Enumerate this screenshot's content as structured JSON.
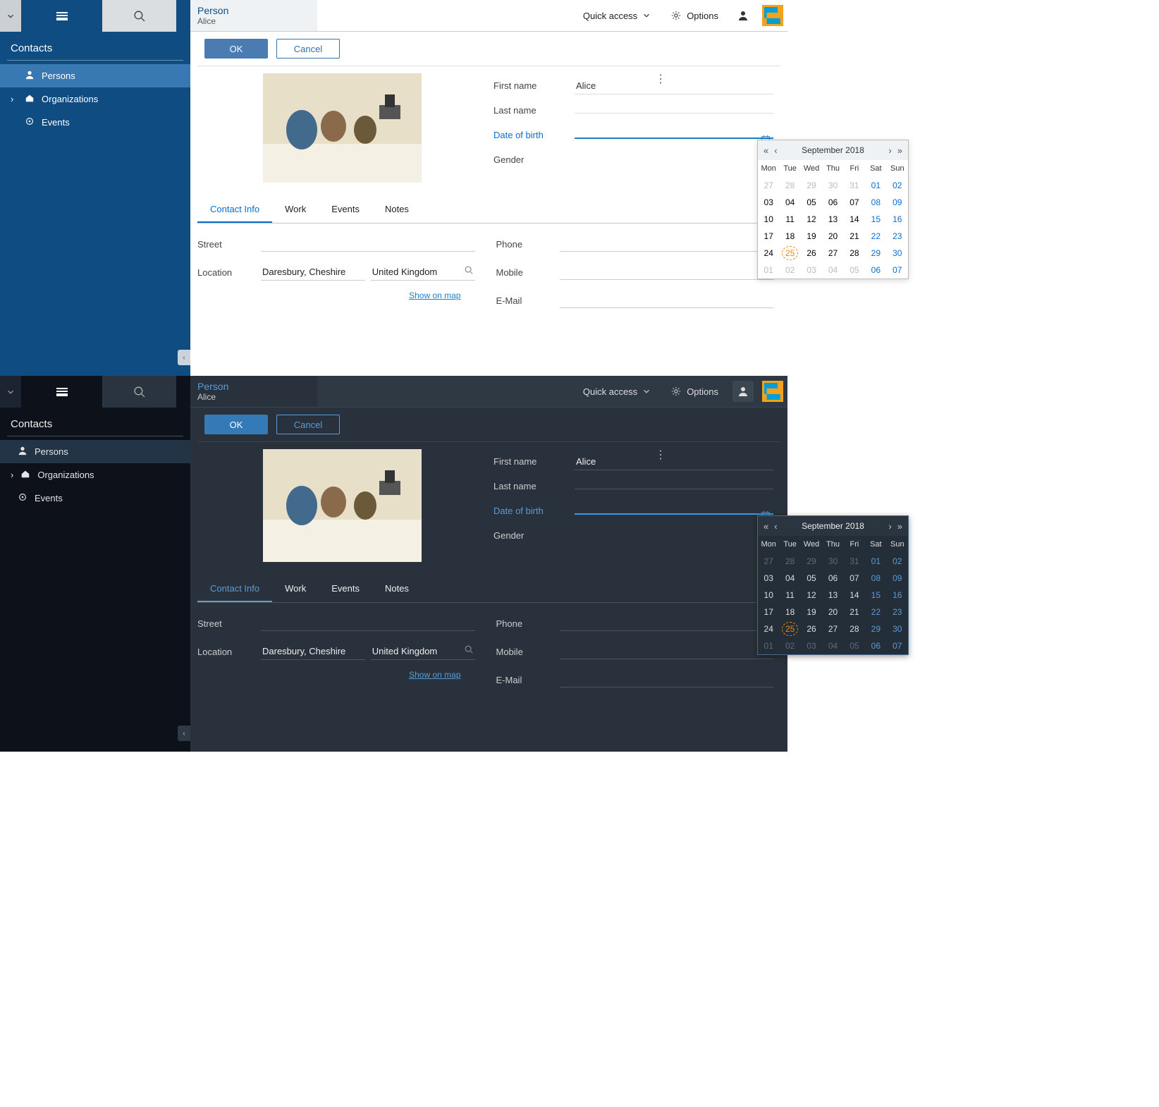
{
  "sidebar": {
    "title": "Contacts",
    "items": [
      {
        "label": "Persons",
        "active": true,
        "expandable": false,
        "icon": "person"
      },
      {
        "label": "Organizations",
        "active": false,
        "expandable": true,
        "icon": "home"
      },
      {
        "label": "Events",
        "active": false,
        "expandable": false,
        "icon": "target"
      }
    ]
  },
  "header": {
    "title": "Person",
    "subtitle": "Alice",
    "quick_access": "Quick access",
    "options": "Options"
  },
  "actions": {
    "ok": "OK",
    "cancel": "Cancel"
  },
  "tabs": [
    {
      "label": "Contact Info",
      "active": true
    },
    {
      "label": "Work",
      "active": false
    },
    {
      "label": "Events",
      "active": false
    },
    {
      "label": "Notes",
      "active": false
    }
  ],
  "fields": {
    "first_name_label": "First name",
    "first_name_value": "Alice",
    "last_name_label": "Last name",
    "last_name_value": "",
    "dob_label": "Date of birth",
    "dob_value": "",
    "gender_label": "Gender",
    "gender_value": ""
  },
  "address": {
    "street_label": "Street",
    "street_value": "",
    "location_label": "Location",
    "city_value": "Daresbury, Cheshire",
    "country_value": "United Kingdom",
    "show_on_map": "Show on map"
  },
  "contact": {
    "phone_label": "Phone",
    "mobile_label": "Mobile",
    "email_label": "E-Mail"
  },
  "calendar": {
    "title": "September 2018",
    "day_headers": [
      "Mon",
      "Tue",
      "Wed",
      "Thu",
      "Fri",
      "Sat",
      "Sun"
    ],
    "rows": [
      [
        {
          "d": "27",
          "cls": "gray"
        },
        {
          "d": "28",
          "cls": "gray"
        },
        {
          "d": "29",
          "cls": "gray"
        },
        {
          "d": "30",
          "cls": "gray"
        },
        {
          "d": "31",
          "cls": "gray"
        },
        {
          "d": "01",
          "cls": "blue"
        },
        {
          "d": "02",
          "cls": "blue"
        }
      ],
      [
        {
          "d": "03"
        },
        {
          "d": "04"
        },
        {
          "d": "05"
        },
        {
          "d": "06"
        },
        {
          "d": "07"
        },
        {
          "d": "08",
          "cls": "blue"
        },
        {
          "d": "09",
          "cls": "blue"
        }
      ],
      [
        {
          "d": "10"
        },
        {
          "d": "11"
        },
        {
          "d": "12"
        },
        {
          "d": "13"
        },
        {
          "d": "14"
        },
        {
          "d": "15",
          "cls": "blue"
        },
        {
          "d": "16",
          "cls": "blue"
        }
      ],
      [
        {
          "d": "17"
        },
        {
          "d": "18"
        },
        {
          "d": "19"
        },
        {
          "d": "20"
        },
        {
          "d": "21"
        },
        {
          "d": "22",
          "cls": "blue"
        },
        {
          "d": "23",
          "cls": "blue"
        }
      ],
      [
        {
          "d": "24"
        },
        {
          "d": "25",
          "cls": "today"
        },
        {
          "d": "26"
        },
        {
          "d": "27"
        },
        {
          "d": "28"
        },
        {
          "d": "29",
          "cls": "blue"
        },
        {
          "d": "30",
          "cls": "blue"
        }
      ],
      [
        {
          "d": "01",
          "cls": "gray"
        },
        {
          "d": "02",
          "cls": "gray"
        },
        {
          "d": "03",
          "cls": "gray"
        },
        {
          "d": "04",
          "cls": "gray"
        },
        {
          "d": "05",
          "cls": "gray"
        },
        {
          "d": "06",
          "cls": "blue"
        },
        {
          "d": "07",
          "cls": "blue"
        }
      ]
    ]
  }
}
